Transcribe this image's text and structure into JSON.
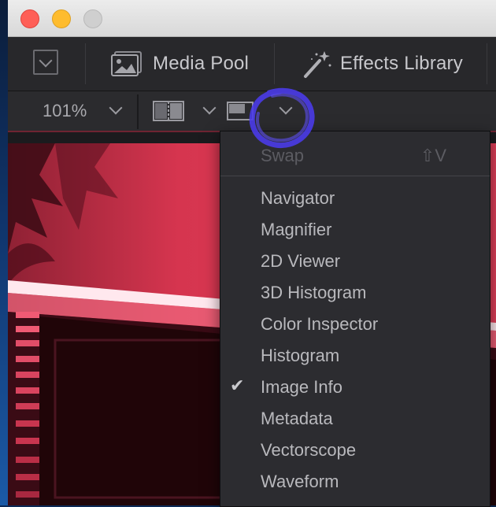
{
  "window": {
    "title_buttons": [
      "close",
      "minimize",
      "maximize"
    ]
  },
  "toolbar": {
    "panel_toggle_icon": "chevron-down-icon",
    "media_pool_label": "Media Pool",
    "media_pool_icon": "photo-icon",
    "effects_library_label": "Effects Library",
    "effects_library_icon": "magic-wand-icon"
  },
  "viewer_bar": {
    "zoom_label": "101%",
    "split_icon": "split-view-icon",
    "scope_icon": "viewer-mode-icon"
  },
  "menu": {
    "swap_label": "Swap",
    "swap_shortcut": "⇧V",
    "items": [
      {
        "label": "Navigator",
        "checked": false
      },
      {
        "label": "Magnifier",
        "checked": false
      },
      {
        "label": "2D Viewer",
        "checked": false
      },
      {
        "label": "3D Histogram",
        "checked": false
      },
      {
        "label": "Color Inspector",
        "checked": false
      },
      {
        "label": "Histogram",
        "checked": false
      },
      {
        "label": "Image Info",
        "checked": true
      },
      {
        "label": "Metadata",
        "checked": false
      },
      {
        "label": "Vectorscope",
        "checked": false
      },
      {
        "label": "Waveform",
        "checked": false
      }
    ],
    "check_glyph": "✔"
  },
  "colors": {
    "accent": "#5a48f0",
    "viewer_tint": "#d9344f",
    "menu_bg": "#2c2c30"
  }
}
